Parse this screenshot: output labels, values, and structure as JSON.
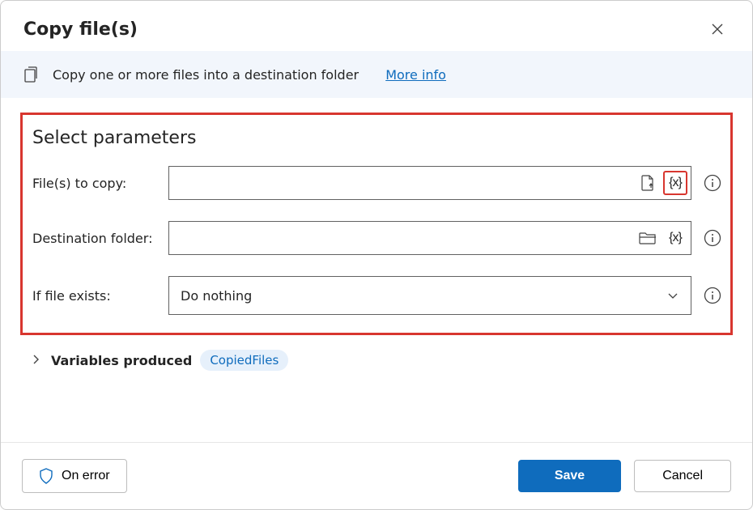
{
  "dialog": {
    "title": "Copy file(s)",
    "banner_text": "Copy one or more files into a destination folder",
    "more_info": "More info"
  },
  "form": {
    "section_title": "Select parameters",
    "files_to_copy": {
      "label": "File(s) to copy:",
      "value": ""
    },
    "destination_folder": {
      "label": "Destination folder:",
      "value": ""
    },
    "if_file_exists": {
      "label": "If file exists:",
      "value": "Do nothing"
    },
    "variable_token": "{x}"
  },
  "variables_produced": {
    "label": "Variables produced",
    "chip": "CopiedFiles"
  },
  "footer": {
    "on_error": "On error",
    "save": "Save",
    "cancel": "Cancel"
  }
}
